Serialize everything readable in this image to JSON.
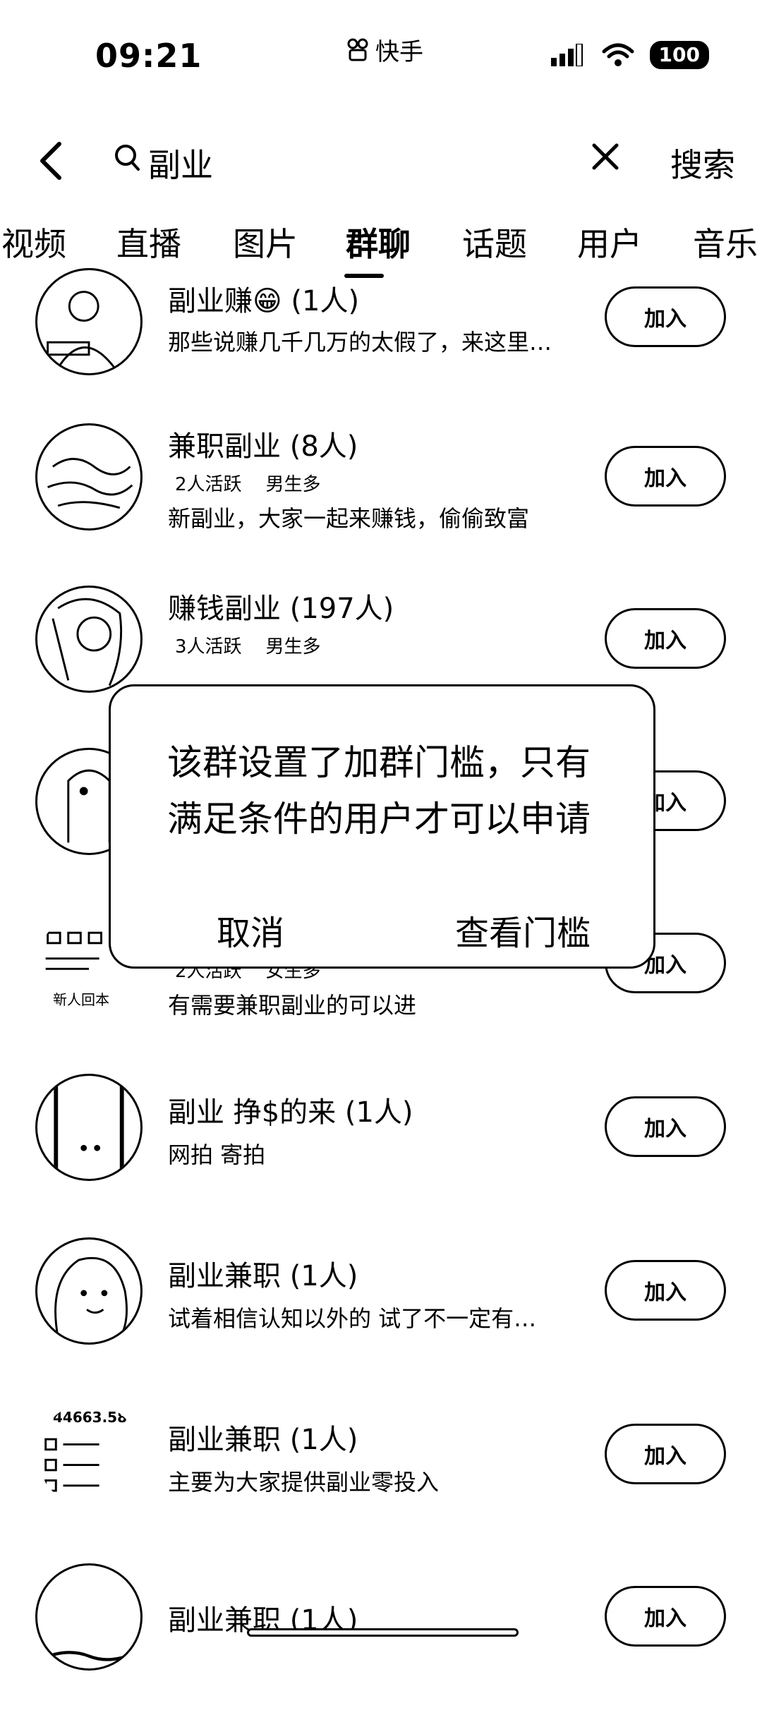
{
  "status_bar": {
    "time": "09:21",
    "app_name": "快手",
    "battery": "100"
  },
  "search": {
    "query": "副业",
    "search_button": "搜索"
  },
  "tabs": [
    {
      "label": "视频"
    },
    {
      "label": "直播"
    },
    {
      "label": "图片"
    },
    {
      "label": "群聊"
    },
    {
      "label": "话题"
    },
    {
      "label": "用户"
    },
    {
      "label": "音乐"
    }
  ],
  "active_tab": "群聊",
  "groups": [
    {
      "title": "副业赚😁 (1人)",
      "tags": [],
      "desc": "那些说赚几千几万的太假了，来这里…",
      "join": "加入"
    },
    {
      "title": "兼职副业 (8人)",
      "tags": [
        "2人活跃",
        "男生多"
      ],
      "desc": "新副业，大家一起来赚钱，偷偷致富",
      "join": "加入"
    },
    {
      "title": "赚钱副业 (197人)",
      "tags": [
        "3人活跃",
        "男生多"
      ],
      "desc": "",
      "join": "加入"
    },
    {
      "title": "",
      "tags": [],
      "desc": "",
      "join": "加入"
    },
    {
      "title": "",
      "tags": [
        "2人活跃",
        "女生多"
      ],
      "desc": "有需要兼职副业的可以进",
      "join": "加入",
      "avatar_text": "新人回本"
    },
    {
      "title": "副业 挣$的来 (1人)",
      "tags": [],
      "desc": "网拍 寄拍",
      "join": "加入"
    },
    {
      "title": "副业兼职 (1人)",
      "tags": [],
      "desc": "试着相信认知以外的 试了不一定有…",
      "join": "加入"
    },
    {
      "title": "副业兼职 (1人)",
      "tags": [],
      "desc": "主要为大家提供副业零投入",
      "join": "加入",
      "avatar_text": "44663.58"
    },
    {
      "title": "副业兼职 (1人)",
      "tags": [],
      "desc": "",
      "join": "加入"
    }
  ],
  "dialog": {
    "message": "该群设置了加群门槛，只有满足条件的用户才可以申请",
    "cancel": "取消",
    "confirm": "查看门槛"
  }
}
